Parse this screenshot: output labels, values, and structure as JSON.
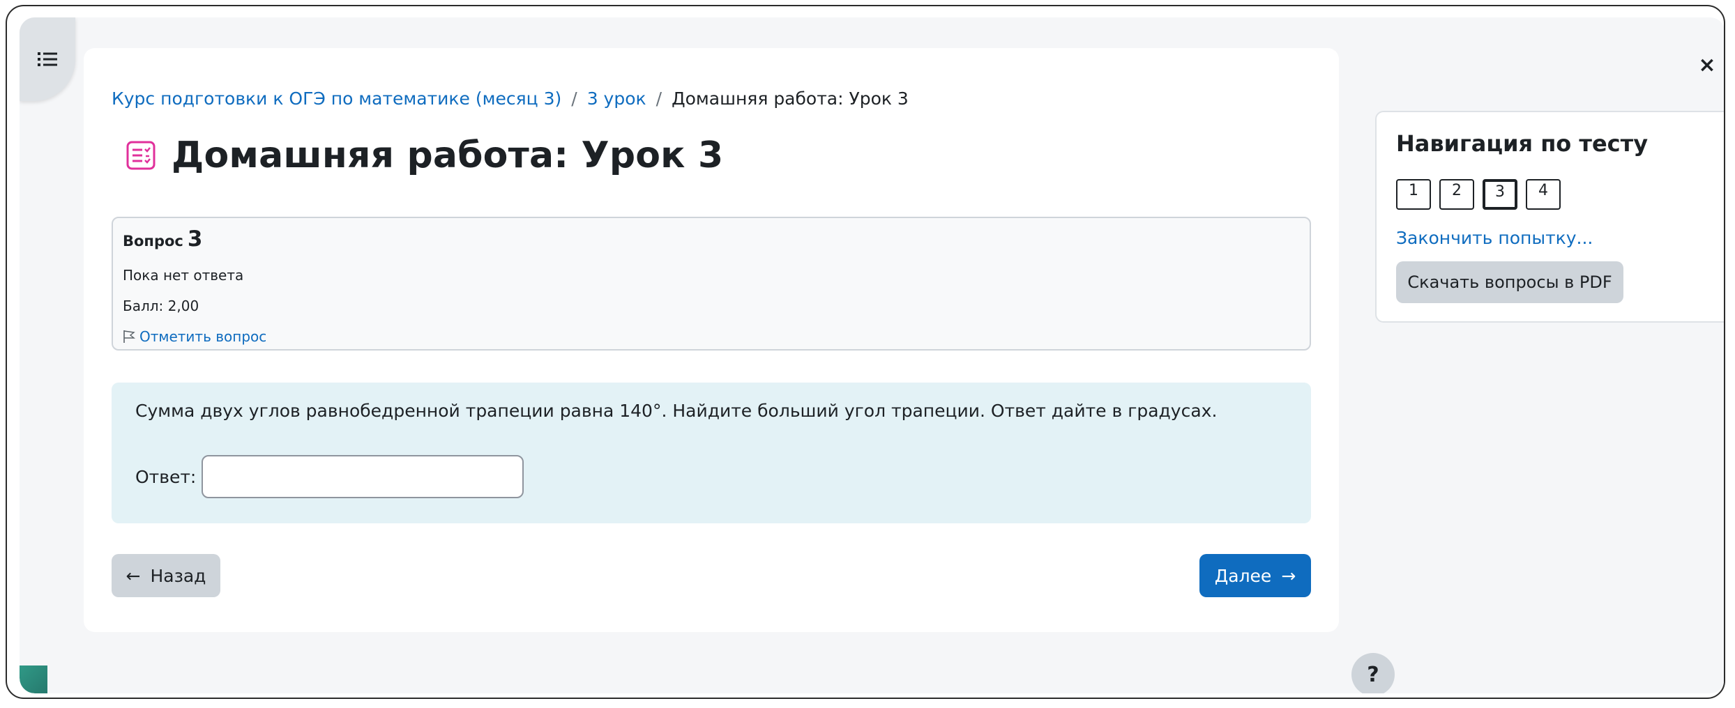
{
  "breadcrumb": {
    "course": "Курс подготовки к ОГЭ по математике (месяц 3)",
    "separator": "/",
    "lesson": "3 урок",
    "current": "Домашняя работа: Урок 3"
  },
  "page": {
    "title": "Домашняя работа: Урок 3",
    "icon": "quiz-icon",
    "accent_color": "#e0309b"
  },
  "question_info": {
    "label": "Вопрос",
    "number": "3",
    "status": "Пока нет ответа",
    "grade": "Балл: 2,00",
    "flag_label": "Отметить вопрос",
    "flag_icon": "flag-icon"
  },
  "question": {
    "text": "Сумма двух углов равнобедренной трапеции равна 140°. Найдите больший угол трапеции. Ответ дайте в градусах.",
    "answer_label": "Ответ:",
    "answer_value": ""
  },
  "buttons": {
    "back_arrow": "←",
    "back": "Назад",
    "next": "Далее",
    "next_arrow": "→",
    "help": "?",
    "close": "×"
  },
  "quiz_nav": {
    "title": "Навигация по тесту",
    "questions": [
      "1",
      "2",
      "3",
      "4"
    ],
    "current_index": 2,
    "finish_link": "Закончить попытку...",
    "pdf_button": "Скачать вопросы в PDF"
  },
  "colors": {
    "link": "#0f6cbf",
    "primary_button": "#0f6cbf",
    "secondary_button": "#ced4da",
    "question_bg": "#e3f2f6"
  }
}
